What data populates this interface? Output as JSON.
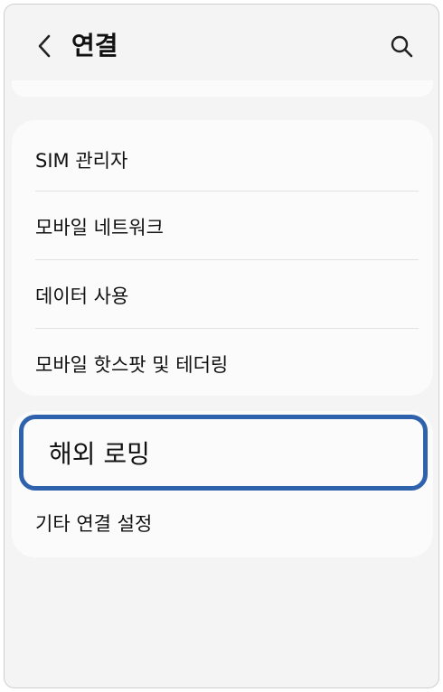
{
  "header": {
    "title": "연결",
    "back_icon": "chevron-left-icon",
    "search_icon": "search-icon"
  },
  "menu": {
    "items": [
      {
        "label": "SIM 관리자"
      },
      {
        "label": "모바일 네트워크"
      },
      {
        "label": "데이터 사용"
      },
      {
        "label": "모바일 핫스팟 및 테더링"
      }
    ]
  },
  "menu2": {
    "highlighted": {
      "label": "해외 로밍"
    },
    "items": [
      {
        "label": "기타 연결 설정"
      }
    ]
  },
  "colors": {
    "background": "#f4f4f4",
    "card": "#fbfbfb",
    "highlight_border": "#2f62ad",
    "divider": "#e2e2e2"
  }
}
